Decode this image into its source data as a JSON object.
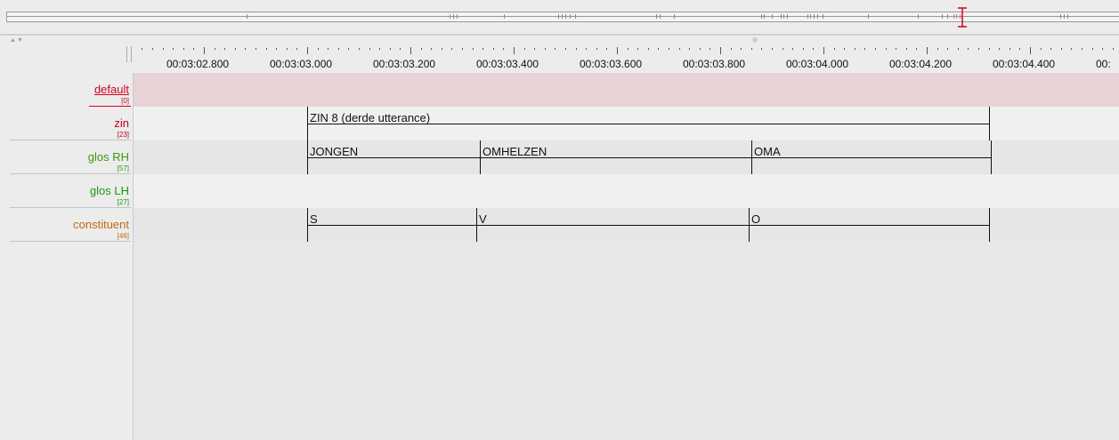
{
  "overview": {
    "cursor_icon": "text-cursor-icon",
    "cursor_color": "#d0021b"
  },
  "header": {
    "collapse_arrows": "▲▼"
  },
  "ruler": {
    "labels": [
      ")",
      "00:03:02.800",
      "00:03:03.000",
      "00:03:03.200",
      "00:03:03.400",
      "00:03:03.600",
      "00:03:03.800",
      "00:03:04.000",
      "00:03:04.200",
      "00:03:04.400",
      "00:"
    ]
  },
  "tiers": [
    {
      "name": "default",
      "count": "[0]",
      "color": "#d0021b",
      "underlined": true,
      "row_bg": "#e7d3d5",
      "annotations": []
    },
    {
      "name": "zin",
      "count": "[23]",
      "color": "#c0001a",
      "underlined": false,
      "row_bg": "#f0f0f0",
      "annotations": [
        {
          "text": "ZIN 8 (derde utterance)",
          "start": "00:03:03.000",
          "end": "00:03:04.320"
        }
      ]
    },
    {
      "name": "glos RH",
      "count": "[57]",
      "color": "#3a9a10",
      "underlined": false,
      "row_bg": "#e6e6e6",
      "annotations": [
        {
          "text": "JONGEN",
          "start": "00:03:03.000",
          "end": "00:03:03.335"
        },
        {
          "text": "OMHELZEN",
          "start": "00:03:03.335",
          "end": "00:03:03.860"
        },
        {
          "text": "OMA",
          "start": "00:03:03.860",
          "end": "00:03:04.325"
        }
      ]
    },
    {
      "name": "glos LH",
      "count": "[27]",
      "color": "#1a9a10",
      "underlined": false,
      "row_bg": "#f0f0f0",
      "annotations": []
    },
    {
      "name": "constituent",
      "count": "[46]",
      "color": "#c06a10",
      "underlined": false,
      "row_bg": "#e6e6e6",
      "annotations": [
        {
          "text": "S",
          "start": "00:03:03.000",
          "end": "00:03:03.328"
        },
        {
          "text": "V",
          "start": "00:03:03.328",
          "end": "00:03:03.855"
        },
        {
          "text": "O",
          "start": "00:03:03.855",
          "end": "00:03:04.320"
        }
      ]
    }
  ]
}
